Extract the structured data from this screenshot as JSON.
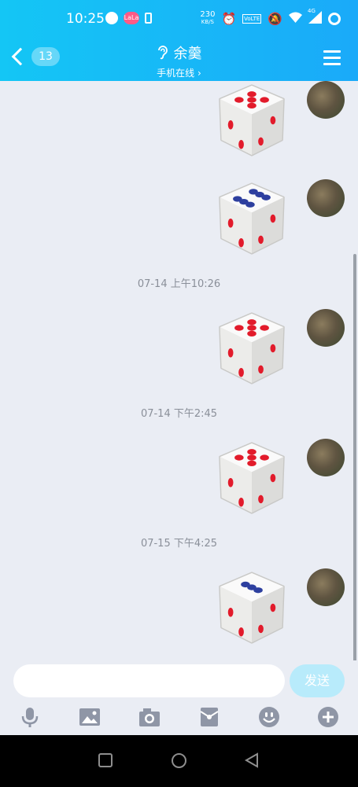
{
  "status_bar": {
    "time": "10:25",
    "network_speed_value": "230",
    "network_speed_unit": "KB/S",
    "signal_label": "4G",
    "volte_label": "VoLTE"
  },
  "header": {
    "back_badge": "13",
    "contact_name": "余羹",
    "status": "手机在线",
    "status_chevron": "›"
  },
  "messages": [
    {
      "type": "dice",
      "face": 5,
      "color": "red"
    },
    {
      "type": "dice",
      "face": 6,
      "color": "blue"
    },
    {
      "type": "timestamp",
      "text": "07-14 上午10:26"
    },
    {
      "type": "dice",
      "face": 5,
      "color": "red"
    },
    {
      "type": "timestamp",
      "text": "07-14 下午2:45"
    },
    {
      "type": "dice",
      "face": 5,
      "color": "red"
    },
    {
      "type": "timestamp",
      "text": "07-15 下午4:25"
    },
    {
      "type": "dice",
      "face": 3,
      "color": "blue"
    }
  ],
  "input": {
    "placeholder": "",
    "send_label": "发送"
  },
  "toolbar": [
    "microphone-icon",
    "image-icon",
    "camera-icon",
    "red-packet-icon",
    "emoji-icon",
    "plus-icon"
  ],
  "colors": {
    "header_start": "#14c6f5",
    "header_end": "#1aaaf9",
    "background": "#eaedf4",
    "send_button": "#b8ebfb",
    "dice_red": "#e21b2b",
    "dice_blue": "#2d3f9f"
  }
}
